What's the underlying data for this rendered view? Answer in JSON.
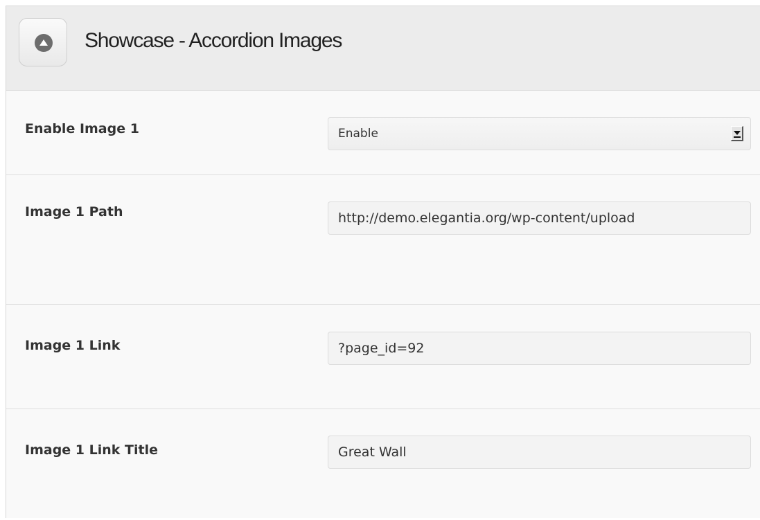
{
  "section": {
    "title": "Showcase - Accordion Images",
    "toggle_icon": "collapse-up-icon"
  },
  "fields": [
    {
      "label": "Enable Image 1",
      "type": "select",
      "value": "Enable"
    },
    {
      "label": "Image 1 Path",
      "type": "text",
      "value": "http://demo.elegantia.org/wp-content/upload"
    },
    {
      "label": "Image 1 Link",
      "type": "text",
      "value": "?page_id=92"
    },
    {
      "label": "Image 1 Link Title",
      "type": "text",
      "value": "Great Wall"
    }
  ],
  "colors": {
    "header_bg": "#ececec",
    "panel_bg": "#f9f9f9",
    "field_bg": "#f3f3f3",
    "label_text": "#333333"
  }
}
